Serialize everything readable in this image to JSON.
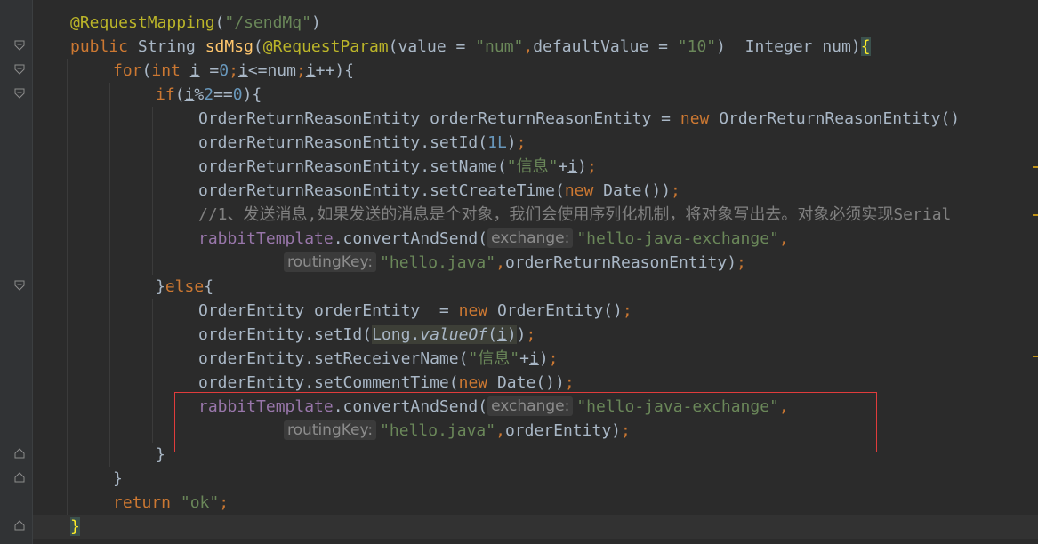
{
  "editor": {
    "lines": [
      {
        "indent": 0,
        "tokens": [
          {
            "c": "ann",
            "t": "@RequestMapping"
          },
          {
            "c": "",
            "t": "("
          },
          {
            "c": "str",
            "t": "\"/sendMq\""
          },
          {
            "c": "",
            "t": ")"
          }
        ]
      },
      {
        "indent": 0,
        "tokens": [
          {
            "c": "kw",
            "t": "public "
          },
          {
            "c": "",
            "t": "String "
          },
          {
            "c": "fn",
            "t": "sdMsg"
          },
          {
            "c": "",
            "t": "("
          },
          {
            "c": "ann",
            "t": "@RequestParam"
          },
          {
            "c": "",
            "t": "(value = "
          },
          {
            "c": "str",
            "t": "\"num\""
          },
          {
            "c": "kw",
            "t": ","
          },
          {
            "c": "",
            "t": "defaultValue = "
          },
          {
            "c": "str",
            "t": "\"10\""
          },
          {
            "c": "",
            "t": ")  Integer num)"
          },
          {
            "c": "paren-hl",
            "t": "{"
          }
        ]
      },
      {
        "indent": 1,
        "tokens": [
          {
            "c": "kw",
            "t": "for"
          },
          {
            "c": "",
            "t": "("
          },
          {
            "c": "kw",
            "t": "int "
          },
          {
            "c": "ul",
            "t": "i"
          },
          {
            "c": "",
            "t": " ="
          },
          {
            "c": "num",
            "t": "0"
          },
          {
            "c": "kw",
            "t": ";"
          },
          {
            "c": "ul",
            "t": "i"
          },
          {
            "c": "",
            "t": "<=num"
          },
          {
            "c": "kw",
            "t": ";"
          },
          {
            "c": "ul",
            "t": "i"
          },
          {
            "c": "",
            "t": "++){"
          }
        ]
      },
      {
        "indent": 2,
        "tokens": [
          {
            "c": "kw",
            "t": "if"
          },
          {
            "c": "",
            "t": "("
          },
          {
            "c": "ul",
            "t": "i"
          },
          {
            "c": "",
            "t": "%"
          },
          {
            "c": "num",
            "t": "2"
          },
          {
            "c": "",
            "t": "=="
          },
          {
            "c": "num",
            "t": "0"
          },
          {
            "c": "",
            "t": "){"
          }
        ]
      },
      {
        "indent": 3,
        "tokens": [
          {
            "c": "",
            "t": "OrderReturnReasonEntity orderReturnReasonEntity = "
          },
          {
            "c": "kw",
            "t": "new "
          },
          {
            "c": "",
            "t": "OrderReturnReasonEntity()"
          }
        ]
      },
      {
        "indent": 3,
        "tokens": [
          {
            "c": "",
            "t": "orderReturnReasonEntity.setId("
          },
          {
            "c": "num",
            "t": "1L"
          },
          {
            "c": "",
            "t": ")"
          },
          {
            "c": "kw",
            "t": ";"
          }
        ]
      },
      {
        "indent": 3,
        "tokens": [
          {
            "c": "",
            "t": "orderReturnReasonEntity.setName("
          },
          {
            "c": "str",
            "t": "\"信息\""
          },
          {
            "c": "",
            "t": "+"
          },
          {
            "c": "ul",
            "t": "i"
          },
          {
            "c": "",
            "t": ")"
          },
          {
            "c": "kw",
            "t": ";"
          }
        ]
      },
      {
        "indent": 3,
        "tokens": [
          {
            "c": "",
            "t": "orderReturnReasonEntity.setCreateTime("
          },
          {
            "c": "kw",
            "t": "new "
          },
          {
            "c": "",
            "t": "Date())"
          },
          {
            "c": "kw",
            "t": ";"
          }
        ]
      },
      {
        "indent": 3,
        "tokens": [
          {
            "c": "cmt",
            "t": "//1、发送消息,如果发送的消息是个对象，我们会使用序列化机制，将对象写出去。对象必须实现Serial"
          }
        ]
      },
      {
        "indent": 3,
        "tokens": [
          {
            "c": "fld",
            "t": "rabbitTemplate"
          },
          {
            "c": "",
            "t": ".convertAndSend("
          },
          {
            "c": "hint",
            "t": "exchange:"
          },
          {
            "c": "str",
            "t": "\"hello-java-exchange\""
          },
          {
            "c": "kw",
            "t": ","
          }
        ]
      },
      {
        "indent": 5,
        "tokens": [
          {
            "c": "hint",
            "t": "routingKey:"
          },
          {
            "c": "str",
            "t": "\"hello.java\""
          },
          {
            "c": "kw",
            "t": ","
          },
          {
            "c": "",
            "t": "orderReturnReasonEntity)"
          },
          {
            "c": "kw",
            "t": ";"
          }
        ]
      },
      {
        "indent": 2,
        "tokens": [
          {
            "c": "",
            "t": "}"
          },
          {
            "c": "kw",
            "t": "else"
          },
          {
            "c": "",
            "t": "{"
          }
        ]
      },
      {
        "indent": 3,
        "tokens": [
          {
            "c": "",
            "t": "OrderEntity orderEntity  = "
          },
          {
            "c": "kw",
            "t": "new "
          },
          {
            "c": "",
            "t": "OrderEntity()"
          },
          {
            "c": "kw",
            "t": ";"
          }
        ]
      },
      {
        "indent": 3,
        "tokens": [
          {
            "c": "",
            "t": "orderEntity.setId("
          },
          {
            "c": "arg-hl",
            "t": "Long."
          },
          {
            "c": "arg-hl ital",
            "t": "valueOf"
          },
          {
            "c": "arg-hl",
            "t": "("
          },
          {
            "c": "arg-hl ul",
            "t": "i"
          },
          {
            "c": "arg-hl",
            "t": ")"
          },
          {
            "c": "",
            "t": ")"
          },
          {
            "c": "kw",
            "t": ";"
          }
        ]
      },
      {
        "indent": 3,
        "tokens": [
          {
            "c": "",
            "t": "orderEntity.setReceiverName("
          },
          {
            "c": "str",
            "t": "\"信息\""
          },
          {
            "c": "",
            "t": "+"
          },
          {
            "c": "ul",
            "t": "i"
          },
          {
            "c": "",
            "t": ")"
          },
          {
            "c": "kw",
            "t": ";"
          }
        ]
      },
      {
        "indent": 3,
        "tokens": [
          {
            "c": "",
            "t": "orderEntity.setCommentTime("
          },
          {
            "c": "kw",
            "t": "new "
          },
          {
            "c": "",
            "t": "Date())"
          },
          {
            "c": "kw",
            "t": ";"
          }
        ]
      },
      {
        "indent": 3,
        "tokens": [
          {
            "c": "fld",
            "t": "rabbitTemplate"
          },
          {
            "c": "",
            "t": ".convertAndSend("
          },
          {
            "c": "hint",
            "t": "exchange:"
          },
          {
            "c": "str",
            "t": "\"hello-java-exchange\""
          },
          {
            "c": "kw",
            "t": ","
          }
        ]
      },
      {
        "indent": 5,
        "tokens": [
          {
            "c": "hint",
            "t": "routingKey:"
          },
          {
            "c": "str",
            "t": "\"hello.java\""
          },
          {
            "c": "kw",
            "t": ","
          },
          {
            "c": "",
            "t": "orderEntity)"
          },
          {
            "c": "kw",
            "t": ";"
          }
        ]
      },
      {
        "indent": 2,
        "tokens": [
          {
            "c": "",
            "t": "}"
          }
        ]
      },
      {
        "indent": 1,
        "tokens": [
          {
            "c": "",
            "t": "}"
          }
        ]
      },
      {
        "indent": 1,
        "tokens": [
          {
            "c": "kw",
            "t": "return "
          },
          {
            "c": "str",
            "t": "\"ok\""
          },
          {
            "c": "kw",
            "t": ";"
          }
        ]
      },
      {
        "indent": 0,
        "tokens": [
          {
            "c": "paren-hl",
            "t": "}"
          }
        ],
        "current": true
      }
    ],
    "colors": {
      "background": "#2b2b2b",
      "gutter": "#313335",
      "keyword": "#cc7832",
      "annotation": "#bbb529",
      "string": "#6a8759",
      "number": "#6897bb",
      "method": "#ffc66d",
      "comment": "#808080",
      "field": "#9876aa",
      "highlight_box": "#e03c3c"
    }
  }
}
